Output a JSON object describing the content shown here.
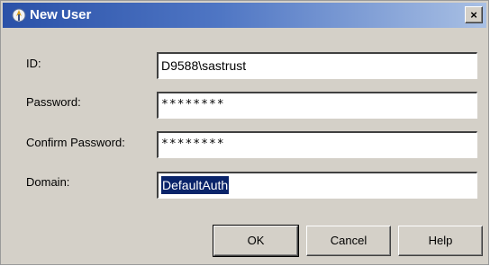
{
  "window": {
    "title": "New User",
    "close_glyph": "×",
    "icon": "sas-user-icon"
  },
  "form": {
    "id_label": "ID:",
    "id_value": "D9588\\sastrust",
    "password_label": "Password:",
    "password_value": "********",
    "confirm_label": "Confirm Password:",
    "confirm_value": "********",
    "domain_label": "Domain:",
    "domain_value": "DefaultAuth"
  },
  "buttons": {
    "ok": "OK",
    "cancel": "Cancel",
    "help": "Help"
  },
  "colors": {
    "title_start": "#2a51a8",
    "title_end": "#a9c0e4",
    "selection": "#0a246a",
    "dialog_bg": "#d4d0c8"
  }
}
